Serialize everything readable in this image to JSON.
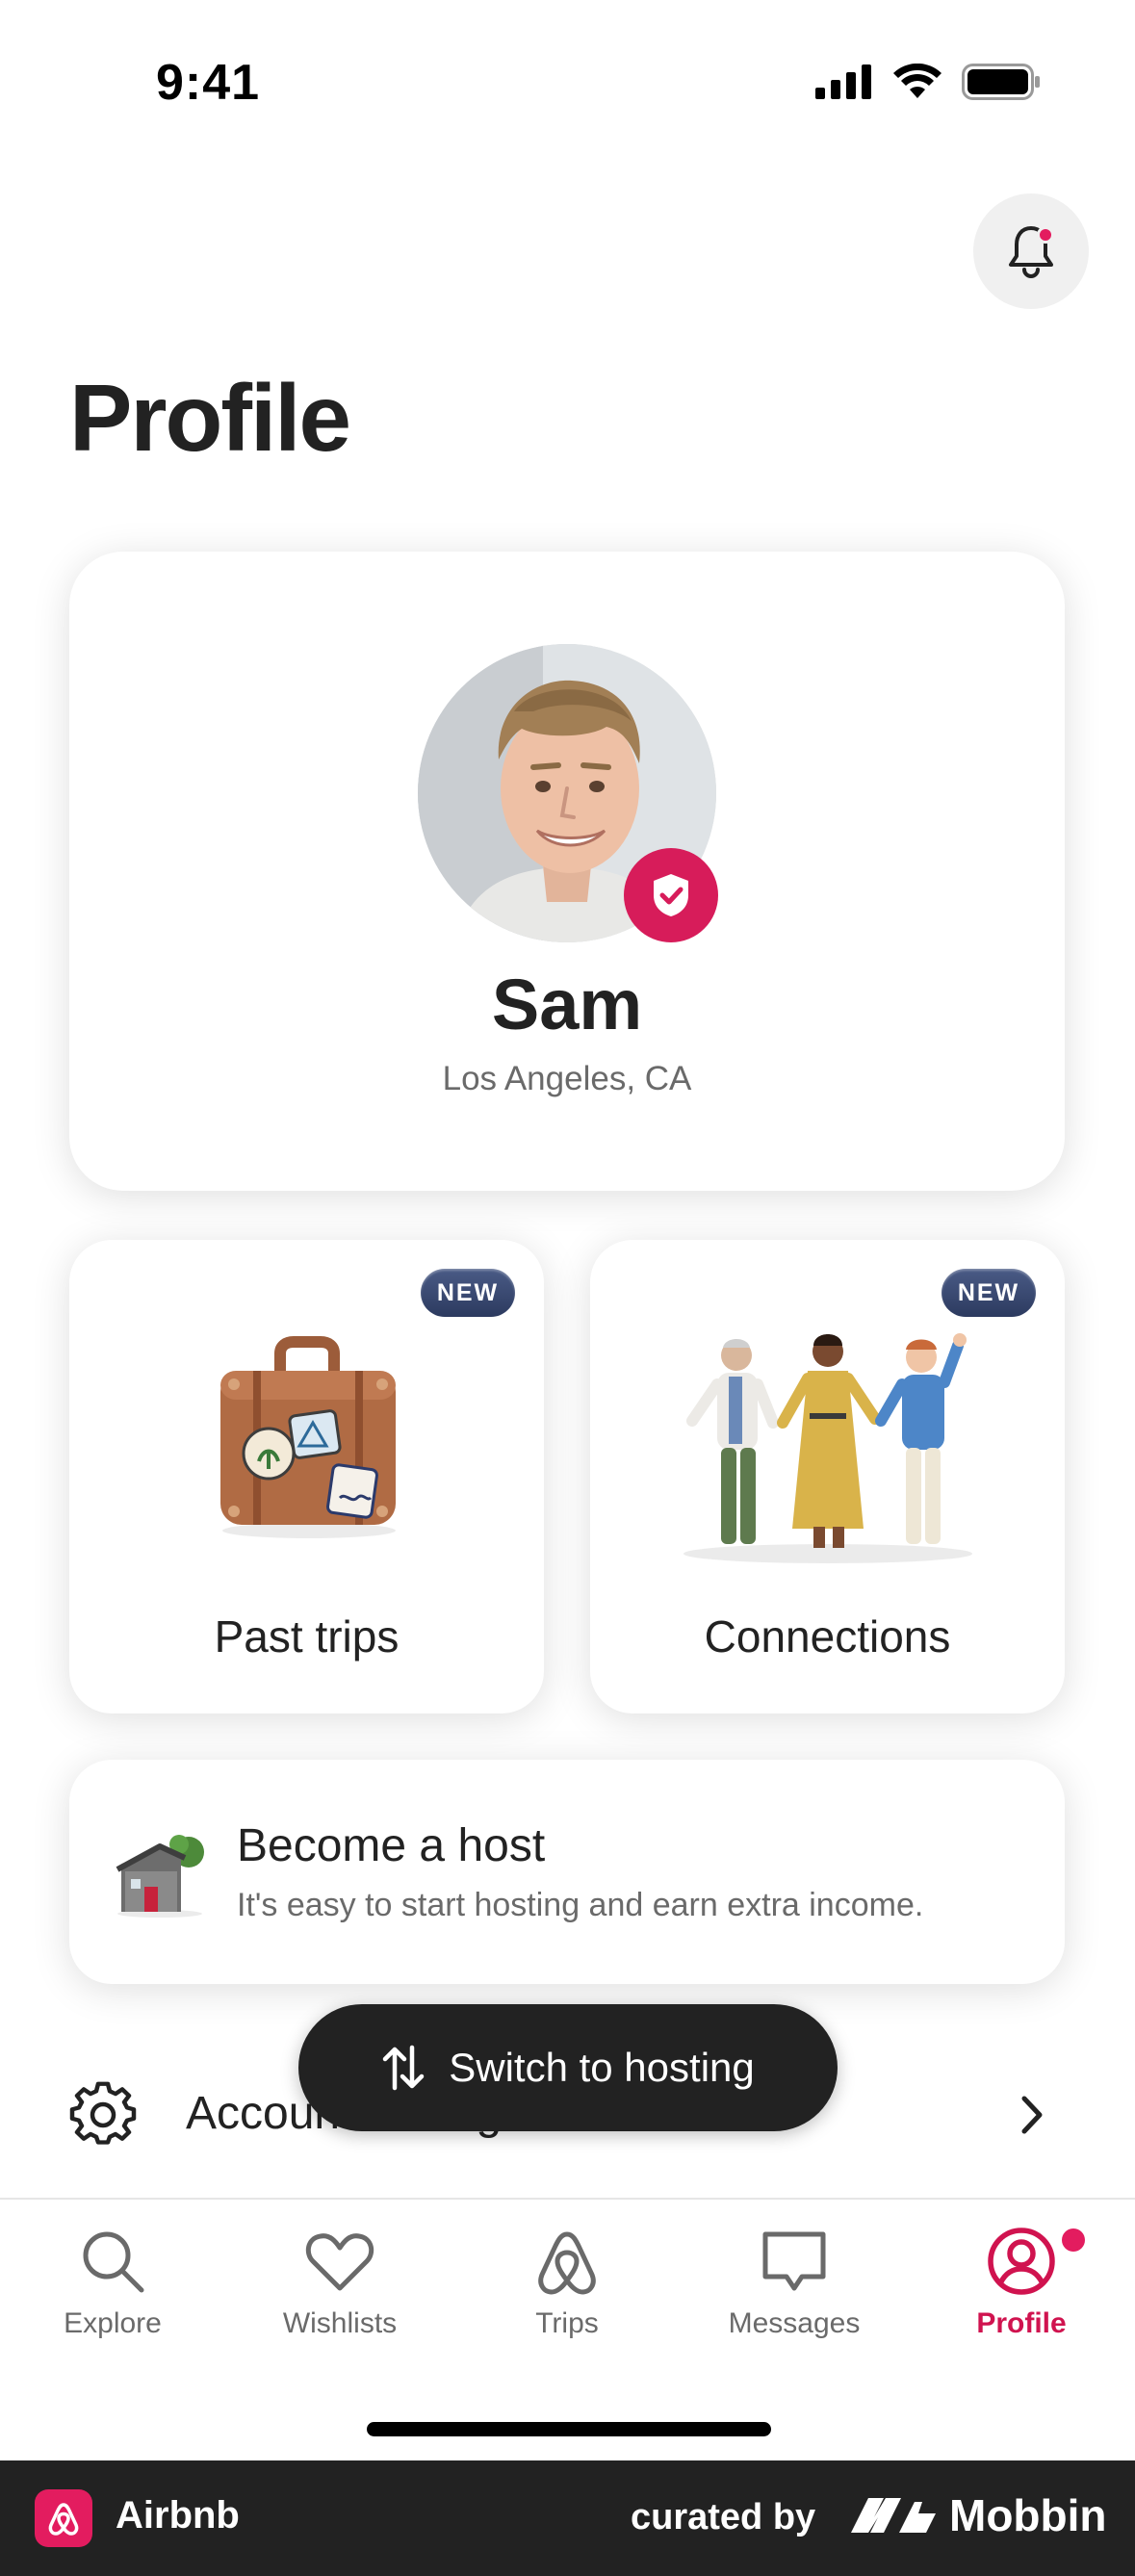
{
  "status": {
    "time": "9:41"
  },
  "page": {
    "title": "Profile"
  },
  "profile": {
    "name": "Sam",
    "location": "Los Angeles, CA"
  },
  "tiles": [
    {
      "label": "Past trips",
      "badge": "NEW"
    },
    {
      "label": "Connections",
      "badge": "NEW"
    }
  ],
  "host": {
    "title": "Become a host",
    "subtitle": "It's easy to start hosting and earn extra income."
  },
  "settings": {
    "label": "Account settings"
  },
  "switch": {
    "label": "Switch to hosting"
  },
  "tabs": [
    {
      "label": "Explore",
      "icon": "search-icon"
    },
    {
      "label": "Wishlists",
      "icon": "heart-icon"
    },
    {
      "label": "Trips",
      "icon": "airbnb-logo-icon"
    },
    {
      "label": "Messages",
      "icon": "message-icon"
    },
    {
      "label": "Profile",
      "icon": "profile-icon",
      "active": true
    }
  ],
  "footer": {
    "app": "Airbnb",
    "curated": "curated by",
    "brand": "Mobbin"
  },
  "colors": {
    "accent": "#e31c5f",
    "active_tab": "#d0134f",
    "dark": "#222222"
  }
}
